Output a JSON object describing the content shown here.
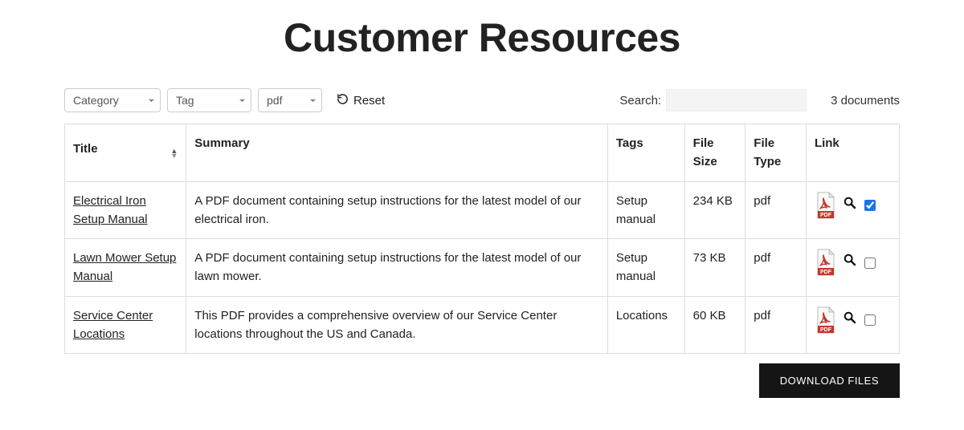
{
  "title": "Customer Resources",
  "filters": {
    "category_label": "Category",
    "tag_label": "Tag",
    "filetype_label": "pdf",
    "reset_label": "Reset"
  },
  "search": {
    "label": "Search:",
    "value": ""
  },
  "doc_count_text": "3 documents",
  "columns": {
    "title": "Title",
    "summary": "Summary",
    "tags": "Tags",
    "filesize": "File Size",
    "filetype": "File Type",
    "link": "Link"
  },
  "rows": [
    {
      "title": "Electrical Iron Setup Manual",
      "summary": "A PDF document containing setup instructions for the latest model of our electrical iron.",
      "tags": "Setup manual",
      "filesize": "234 KB",
      "filetype": "pdf",
      "checked": true
    },
    {
      "title": "Lawn Mower Setup Manual",
      "summary": "A PDF document containing setup instructions for the latest model of our lawn mower.",
      "tags": "Setup manual",
      "filesize": "73 KB",
      "filetype": "pdf",
      "checked": false
    },
    {
      "title": "Service Center Locations",
      "summary": "This PDF provides a comprehensive overview of our Service Center locations throughout the US and Canada.",
      "tags": "Locations",
      "filesize": "60 KB",
      "filetype": "pdf",
      "checked": false
    }
  ],
  "download_label": "DOWNLOAD FILES",
  "icons": {
    "pdf": "pdf-icon",
    "magnifier": "magnifier-icon",
    "reset": "reset-icon",
    "caret": "caret-down-icon",
    "sort": "sort-icon"
  }
}
